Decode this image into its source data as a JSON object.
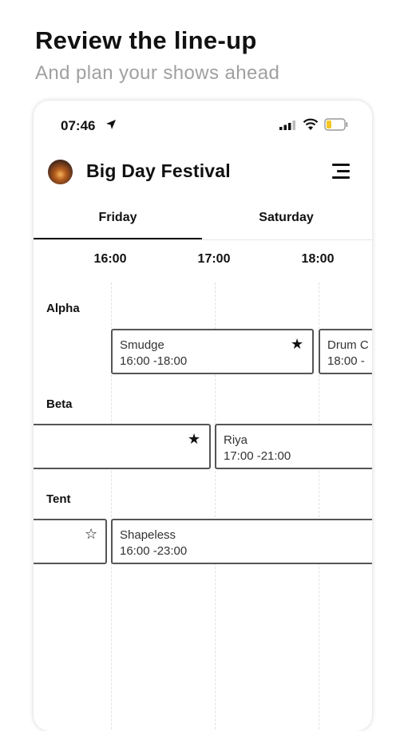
{
  "promo": {
    "title": "Review the line-up",
    "subtitle": "And plan your shows ahead"
  },
  "status_bar": {
    "time": "07:46",
    "icons": [
      "location-arrow-icon",
      "signal-icon",
      "wifi-icon",
      "battery-icon"
    ],
    "battery_color": "#f3c623"
  },
  "header": {
    "title": "Big Day Festival",
    "logo": "festival-logo",
    "menu_icon": "hamburger-menu-icon"
  },
  "tabs": [
    {
      "label": "Friday",
      "active": true
    },
    {
      "label": "Saturday",
      "active": false
    }
  ],
  "timeline": {
    "times": [
      "16:00",
      "17:00",
      "18:00"
    ]
  },
  "stages": [
    {
      "name": "Alpha",
      "events": [
        {
          "name": "Smudge",
          "time": "16:00 -18:00",
          "favorite": true
        },
        {
          "name": "Drum C",
          "time": "18:00 -",
          "favorite": null
        }
      ]
    },
    {
      "name": "Beta",
      "events": [
        {
          "name": "",
          "time": "",
          "favorite": true
        },
        {
          "name": "Riya",
          "time": "17:00 -21:00",
          "favorite": null
        }
      ]
    },
    {
      "name": "Tent",
      "events": [
        {
          "name": "",
          "time": "",
          "favorite": false
        },
        {
          "name": "Shapeless",
          "time": "16:00 -23:00",
          "favorite": null
        }
      ]
    }
  ],
  "colors": {
    "text": "#111111",
    "subtitle": "#a0a0a0",
    "event_border": "#555555"
  }
}
